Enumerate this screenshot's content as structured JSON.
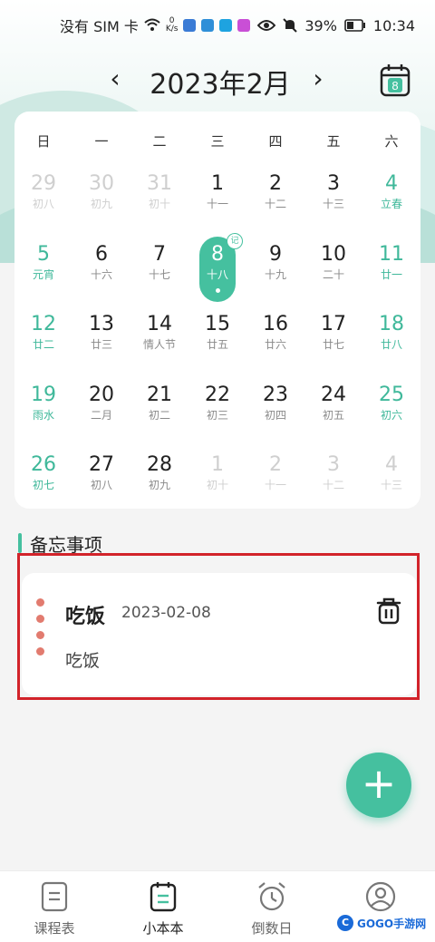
{
  "status_bar": {
    "carrier": "没有 SIM 卡",
    "speed_value": "0",
    "speed_unit": "K/s",
    "battery": "39%",
    "time": "10:34"
  },
  "header": {
    "month_title": "2023年2月",
    "prev_icon": "chevron-left-icon",
    "next_icon": "chevron-right-icon",
    "calendar_today_num": "8"
  },
  "calendar": {
    "weekdays": [
      "日",
      "一",
      "二",
      "三",
      "四",
      "五",
      "六"
    ],
    "accent": "#45c09f",
    "selected_badge": "记",
    "days": [
      {
        "num": "29",
        "sub": "初八",
        "muted": true
      },
      {
        "num": "30",
        "sub": "初九",
        "muted": true
      },
      {
        "num": "31",
        "sub": "初十",
        "muted": true
      },
      {
        "num": "1",
        "sub": "十一"
      },
      {
        "num": "2",
        "sub": "十二"
      },
      {
        "num": "3",
        "sub": "十三"
      },
      {
        "num": "4",
        "sub": "立春",
        "weekend": true
      },
      {
        "num": "5",
        "sub": "元宵",
        "weekend": true
      },
      {
        "num": "6",
        "sub": "十六"
      },
      {
        "num": "7",
        "sub": "十七"
      },
      {
        "num": "8",
        "sub": "十八",
        "selected": true
      },
      {
        "num": "9",
        "sub": "十九"
      },
      {
        "num": "10",
        "sub": "二十"
      },
      {
        "num": "11",
        "sub": "廿一",
        "weekend": true
      },
      {
        "num": "12",
        "sub": "廿二",
        "weekend": true
      },
      {
        "num": "13",
        "sub": "廿三"
      },
      {
        "num": "14",
        "sub": "情人节"
      },
      {
        "num": "15",
        "sub": "廿五"
      },
      {
        "num": "16",
        "sub": "廿六"
      },
      {
        "num": "17",
        "sub": "廿七"
      },
      {
        "num": "18",
        "sub": "廿八",
        "weekend": true
      },
      {
        "num": "19",
        "sub": "雨水",
        "weekend": true
      },
      {
        "num": "20",
        "sub": "二月"
      },
      {
        "num": "21",
        "sub": "初二"
      },
      {
        "num": "22",
        "sub": "初三"
      },
      {
        "num": "23",
        "sub": "初四"
      },
      {
        "num": "24",
        "sub": "初五"
      },
      {
        "num": "25",
        "sub": "初六",
        "weekend": true
      },
      {
        "num": "26",
        "sub": "初七",
        "weekend": true
      },
      {
        "num": "27",
        "sub": "初八"
      },
      {
        "num": "28",
        "sub": "初九"
      },
      {
        "num": "1",
        "sub": "初十",
        "muted": true
      },
      {
        "num": "2",
        "sub": "十一",
        "muted": true
      },
      {
        "num": "3",
        "sub": "十二",
        "muted": true
      },
      {
        "num": "4",
        "sub": "十三",
        "muted": true,
        "weekend": true
      }
    ]
  },
  "memo_section": {
    "title": "备忘事项",
    "items": [
      {
        "title": "吃饭",
        "date": "2023-02-08",
        "body": "吃饭",
        "delete_icon": "trash-icon"
      }
    ]
  },
  "fab": {
    "label": "+"
  },
  "bottom_nav": {
    "items": [
      {
        "label": "课程表",
        "icon": "schedule-icon"
      },
      {
        "label": "小本本",
        "icon": "notebook-icon",
        "active": true
      },
      {
        "label": "倒数日",
        "icon": "alarm-clock-icon"
      },
      {
        "label": "",
        "icon": "profile-icon"
      }
    ]
  },
  "watermark": {
    "text": "GOGO手游网",
    "logo": "C"
  }
}
